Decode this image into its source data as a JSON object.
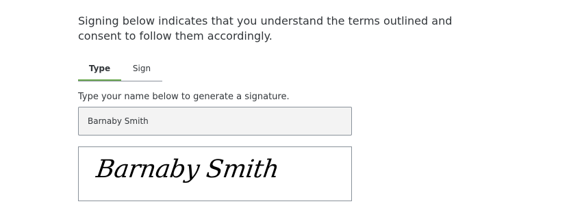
{
  "consent_text": "Signing below indicates that you understand the terms outlined and consent to follow them accordingly.",
  "tabs": [
    {
      "label": "Type",
      "active": true
    },
    {
      "label": "Sign",
      "active": false
    }
  ],
  "instruction": "Type your name below to generate a signature.",
  "name_input": {
    "value": "Barnaby Smith"
  },
  "signature_preview": "Barnaby Smith",
  "colors": {
    "active_tab_underline": "#6aa84f",
    "text": "#32363a",
    "input_background": "#f3f3f3",
    "border": "#89919a"
  }
}
